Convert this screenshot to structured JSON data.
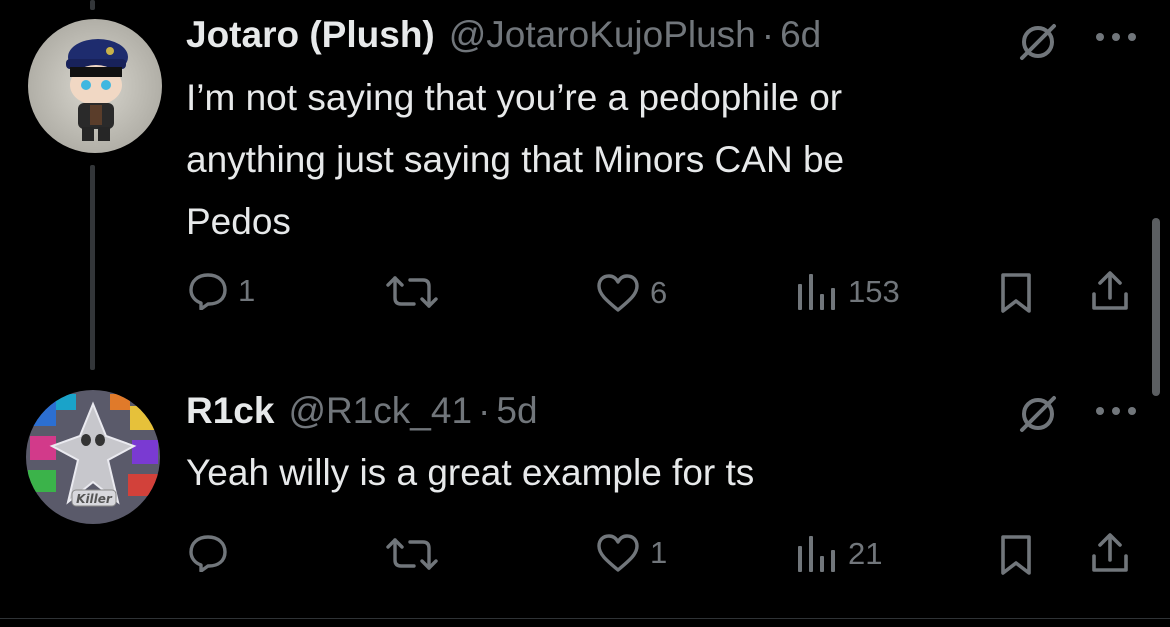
{
  "tweets": [
    {
      "name": "Jotaro (Plush)",
      "handle": "@JotaroKujoPlush",
      "separator": "·",
      "time": "6d",
      "lines": [
        "I’m not saying that you’re a pedophile or",
        "anything just saying that Minors CAN be",
        "Pedos"
      ],
      "replies": "1",
      "retweets": "",
      "likes": "6",
      "views": "153"
    },
    {
      "name": "R1ck",
      "handle": "@R1ck_41",
      "separator": "·",
      "time": "5d",
      "lines": [
        "Yeah willy is a great example for ts"
      ],
      "replies": "",
      "retweets": "",
      "likes": "1",
      "views": "21",
      "avatar_text": "Killer"
    }
  ],
  "colors": {
    "background": "#000000",
    "text": "#e7e9ea",
    "secondary": "#71767b",
    "thread_line": "#333639"
  },
  "icons": [
    "grok-icon",
    "more-icon",
    "reply-icon",
    "retweet-icon",
    "like-icon",
    "views-icon",
    "bookmark-icon",
    "share-icon"
  ]
}
